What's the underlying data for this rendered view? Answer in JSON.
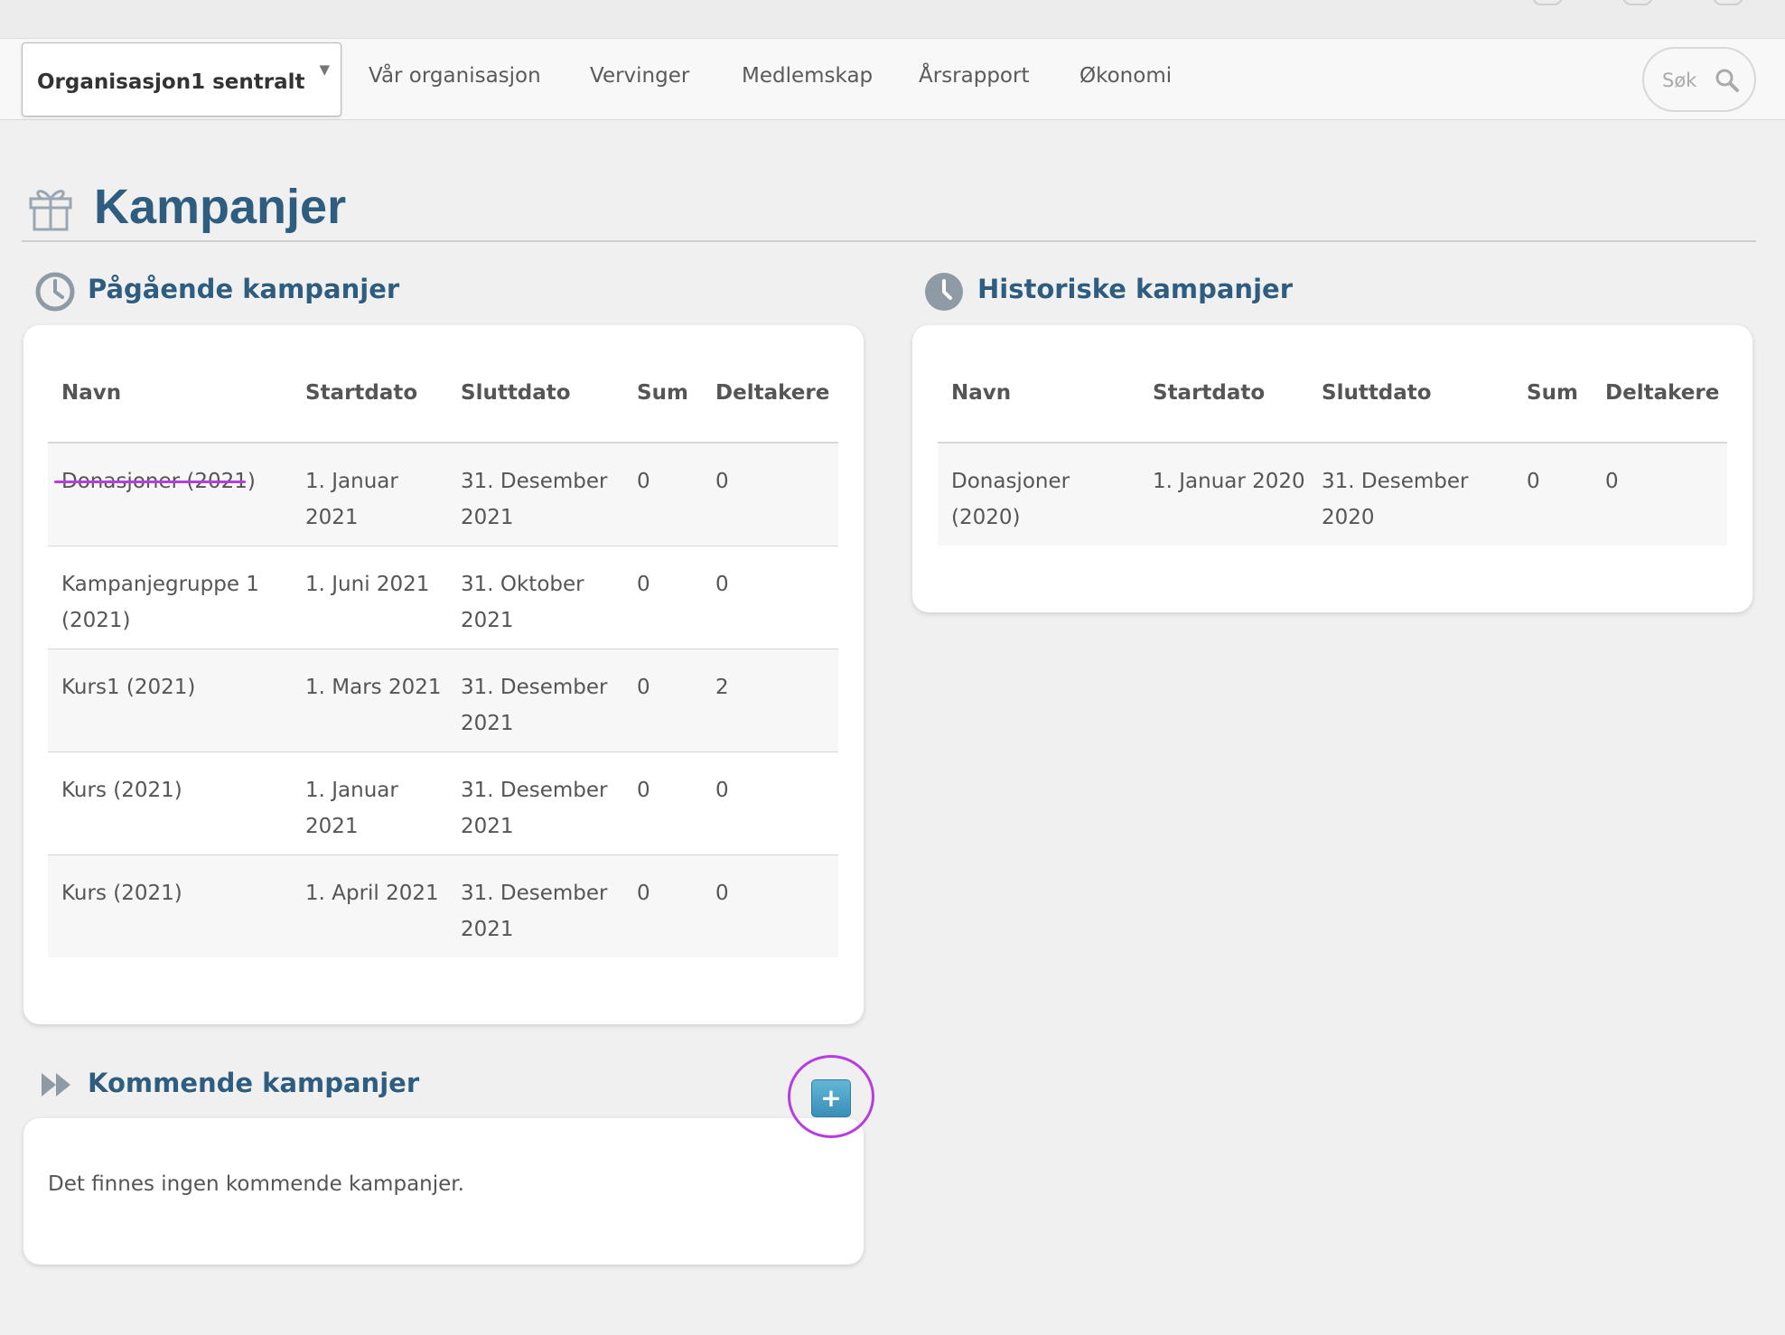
{
  "top_nav": {
    "org_selector": "Organisasjon1 sentralt",
    "items": [
      "Vår organisasjon",
      "Vervinger",
      "Medlemskap",
      "Årsrapport",
      "Økonomi"
    ],
    "search_placeholder": "Søk"
  },
  "page": {
    "title": "Kampanjer"
  },
  "ongoing": {
    "title": "Pågående kampanjer",
    "columns": [
      "Navn",
      "Startdato",
      "Sluttdato",
      "Sum",
      "Deltakere"
    ],
    "rows": [
      {
        "name": "Donasjoner (2021)",
        "start": "1. Januar 2021",
        "end": "31. Desember 2021",
        "sum": "0",
        "participants": "0"
      },
      {
        "name": "Kampanjegruppe 1 (2021)",
        "start": "1. Juni 2021",
        "end": "31. Oktober 2021",
        "sum": "0",
        "participants": "0"
      },
      {
        "name": "Kurs1 (2021)",
        "start": "1. Mars 2021",
        "end": "31. Desember 2021",
        "sum": "0",
        "participants": "2"
      },
      {
        "name": "Kurs (2021)",
        "start": "1. Januar 2021",
        "end": "31. Desember 2021",
        "sum": "0",
        "participants": "0"
      },
      {
        "name": "Kurs (2021)",
        "start": "1. April 2021",
        "end": "31. Desember 2021",
        "sum": "0",
        "participants": "0"
      }
    ]
  },
  "historic": {
    "title": "Historiske kampanjer",
    "columns": [
      "Navn",
      "Startdato",
      "Sluttdato",
      "Sum",
      "Deltakere"
    ],
    "rows": [
      {
        "name": "Donasjoner (2020)",
        "start": "1. Januar 2020",
        "end": "31. Desember 2020",
        "sum": "0",
        "participants": "0"
      }
    ]
  },
  "upcoming": {
    "title": "Kommende kampanjer",
    "add_label": "+",
    "empty_text": "Det finnes ingen kommende kampanjer."
  },
  "colors": {
    "heading": "#2f5d80",
    "highlight": "#b73de0",
    "add_button": "#4a9fc7"
  }
}
